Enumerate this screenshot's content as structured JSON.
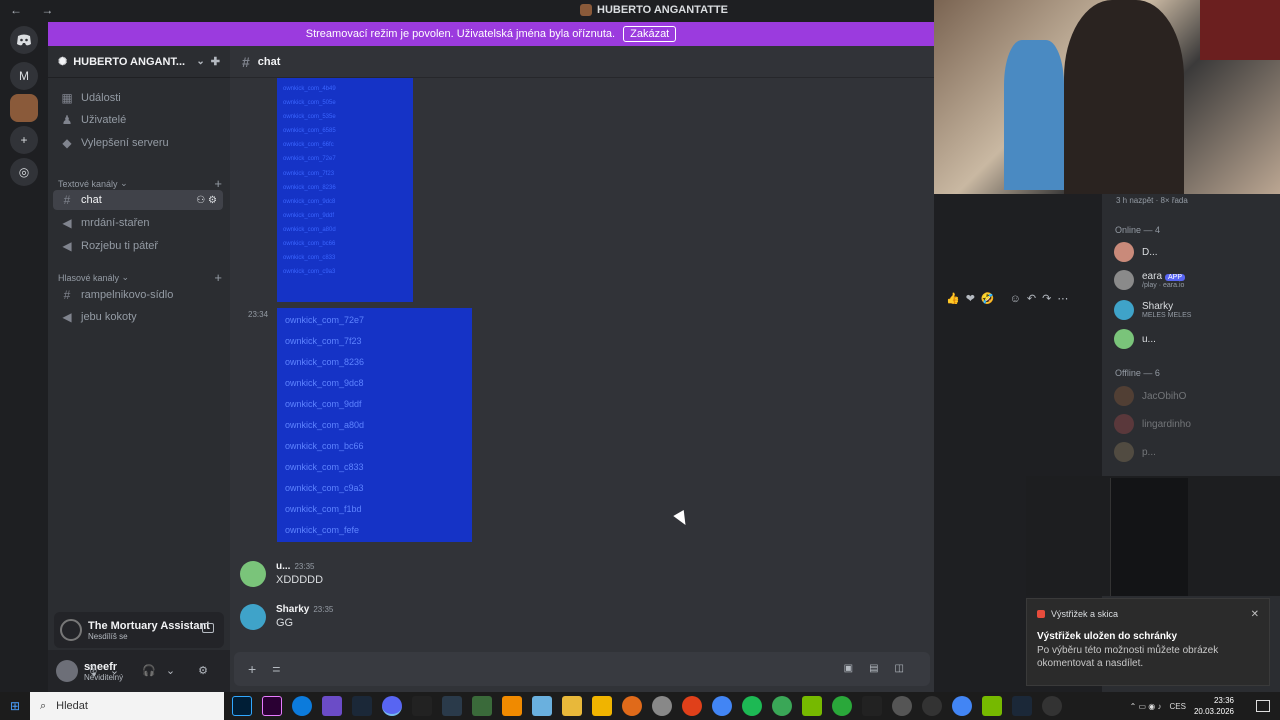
{
  "window": {
    "title": "HUBERTO ANGANTATTE",
    "nav_arrows": "← →"
  },
  "banner": {
    "text": "Streamovací režim je povolen. Uživatelská jména byla oříznuta.",
    "button": "Zakázat"
  },
  "server_rail": {
    "items": [
      "discord-home",
      "M",
      "server-avatar",
      "add-server",
      "discover"
    ],
    "m_label": "M"
  },
  "sidebar": {
    "server_name": "HUBERTO ANGANT...",
    "top_items": [
      {
        "label": "Události",
        "icon": "calendar-icon"
      },
      {
        "label": "Uživatelé",
        "icon": "users-icon"
      },
      {
        "label": "Vylepšení serveru",
        "icon": "boost-icon"
      }
    ],
    "text_category": "Textové kanály",
    "text_channels": [
      {
        "label": "chat",
        "active": true
      },
      {
        "label": "mrdání-stařen",
        "active": false
      },
      {
        "label": "Rozjebu ti páteř",
        "active": false
      }
    ],
    "voice_category": "Hlasové kanály",
    "voice_channels": [
      {
        "label": "rampelnikovo-sídlo",
        "icon": "hash-icon"
      },
      {
        "label": "jebu kokoty",
        "icon": "speaker-icon"
      }
    ],
    "game": {
      "name": "The Mortuary Assistant",
      "status": "Nesdílíš se"
    },
    "user": {
      "name": "sneefr",
      "status": "Neviditelný"
    }
  },
  "chat": {
    "channel": "chat",
    "block1_lines": [
      "ownkick_com_4b49",
      "ownkick_com_505e",
      "ownkick_com_535e",
      "ownkick_com_6585",
      "ownkick_com_66fc",
      "ownkick_com_72e7",
      "ownkick_com_7f23",
      "ownkick_com_8236",
      "ownkick_com_9dc8",
      "ownkick_com_9ddf",
      "ownkick_com_a80d",
      "ownkick_com_bc66",
      "ownkick_com_c833",
      "ownkick_com_c9a3"
    ],
    "block2_time": "23:34",
    "block2_lines": [
      "ownkick_com_72e7",
      "ownkick_com_7f23",
      "ownkick_com_8236",
      "ownkick_com_9dc8",
      "ownkick_com_9ddf",
      "ownkick_com_a80d",
      "ownkick_com_bc66",
      "ownkick_com_c833",
      "ownkick_com_c9a3",
      "ownkick_com_f1bd",
      "ownkick_com_fefe"
    ],
    "messages": [
      {
        "author": "u...",
        "time": "23:35",
        "text": "XDDDDD",
        "avatar_color": "#7ac47a"
      },
      {
        "author": "Sharky",
        "time": "23:35",
        "text": "GG",
        "avatar_color": "#3fa3c9"
      }
    ],
    "composer_placeholder": "="
  },
  "members": {
    "activity": "3 h nazpět · 8× řada",
    "online_header": "Online — 4",
    "online": [
      {
        "name": "D...",
        "status": "",
        "color": "#c98a7a"
      },
      {
        "name": "eara",
        "badge": "APP",
        "status": "/play · eara.io",
        "color": "#8a8a8a"
      },
      {
        "name": "Sharky",
        "status": "MELES MELES",
        "color": "#3fa3c9"
      },
      {
        "name": "u...",
        "status": "",
        "color": "#7ac47a"
      }
    ],
    "offline_header": "Offline — 6",
    "offline": [
      {
        "name": "JacObihO",
        "color": "#8a5a3a"
      },
      {
        "name": "lingardinho",
        "color": "#a04a4a"
      },
      {
        "name": "p...",
        "color": "#8a7a5a"
      }
    ]
  },
  "toast": {
    "app": "Výstřižek a skica",
    "title": "Výstřižek uložen do schránky",
    "body": "Po výběru této možnosti můžete obrázek okomentovat a nasdílet."
  },
  "taskbar": {
    "search": "Hledat",
    "lang": "CES",
    "time": "23:36",
    "date": "20.03.2026"
  },
  "colors": {
    "accent": "#9b3bde",
    "selection_blue": "#1533c6",
    "blurple": "#5865f2"
  }
}
